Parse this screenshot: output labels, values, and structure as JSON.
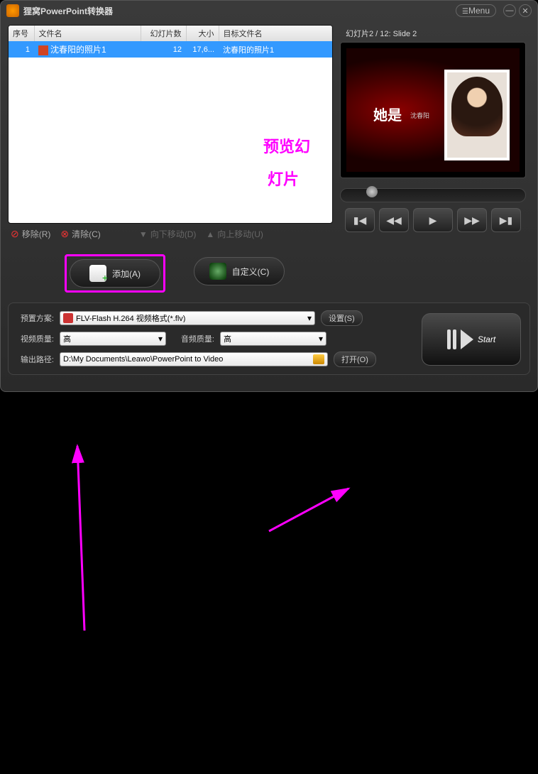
{
  "window": {
    "title": "狸窝PowerPoint转换器",
    "menu_label": "Menu"
  },
  "table": {
    "headers": {
      "seq": "序号",
      "filename": "文件名",
      "slides": "幻灯片数",
      "size": "大小",
      "target": "目标文件名"
    },
    "rows": [
      {
        "seq": "1",
        "filename": "沈春阳的照片1",
        "slides": "12",
        "size": "17,6...",
        "target": "沈春阳的照片1"
      }
    ]
  },
  "toolbar": {
    "remove": "移除(R)",
    "clear": "清除(C)",
    "move_down": "向下移动(D)",
    "move_up": "向上移动(U)"
  },
  "preview": {
    "counter": "幻灯片2 / 12: Slide 2",
    "slide_text": "她是",
    "slide_sub": "沈春阳"
  },
  "big_buttons": {
    "add": "添加(A)",
    "customize": "自定义(C)"
  },
  "bottom": {
    "preset_label": "预置方案:",
    "preset_value": "FLV-Flash H.264 视频格式(*.flv)",
    "settings_btn": "设置(S)",
    "vquality_label": "视频质量:",
    "vquality_value": "高",
    "aquality_label": "音频质量:",
    "aquality_value": "高",
    "output_label": "输出路径:",
    "output_value": "D:\\My Documents\\Leawo\\PowerPoint to Video",
    "open_btn": "打开(O)",
    "start": "Start"
  },
  "annotations": {
    "line1": "预览幻",
    "line2": "灯片"
  }
}
